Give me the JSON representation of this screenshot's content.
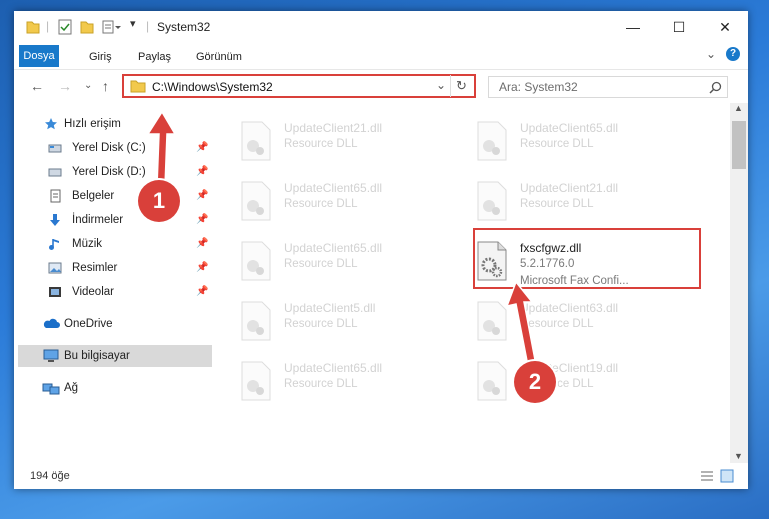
{
  "window": {
    "title": "System32",
    "controls": {
      "minimize": "—",
      "maximize": "☐",
      "close": "✕"
    }
  },
  "ribbon": {
    "tabs": [
      {
        "label": "Dosya",
        "active": true
      },
      {
        "label": "Giriş"
      },
      {
        "label": "Paylaş"
      },
      {
        "label": "Görünüm"
      }
    ]
  },
  "address": {
    "path": "C:\\Windows\\System32"
  },
  "search": {
    "placeholder": "Ara: System32"
  },
  "sidebar": {
    "items": [
      {
        "label": "Hızlı erişim",
        "icon": "star-icon"
      },
      {
        "label": "Yerel Disk (C:)",
        "icon": "drive-icon",
        "pinned": true
      },
      {
        "label": "Yerel Disk (D:)",
        "icon": "drive-icon",
        "pinned": true
      },
      {
        "label": "Belgeler",
        "icon": "documents-icon",
        "pinned": true
      },
      {
        "label": "İndirmeler",
        "icon": "download-icon",
        "pinned": true
      },
      {
        "label": "Müzik",
        "icon": "music-icon",
        "pinned": true
      },
      {
        "label": "Resimler",
        "icon": "pictures-icon",
        "pinned": true
      },
      {
        "label": "Videolar",
        "icon": "videos-icon",
        "pinned": true
      },
      {
        "label": "OneDrive",
        "icon": "onedrive-icon"
      },
      {
        "label": "Bu bilgisayar",
        "icon": "computer-icon",
        "selected": true
      },
      {
        "label": "Ağ",
        "icon": "network-icon"
      }
    ]
  },
  "files": [
    {
      "name": "UpdateClient21.dll",
      "desc": "Resource DLL"
    },
    {
      "name": "UpdateClient65.dll",
      "desc": "Resource DLL"
    },
    {
      "name": "UpdateClient65.dll",
      "desc": "Resource DLL"
    },
    {
      "name": "UpdateClient21.dll",
      "desc": "Resource DLL"
    },
    {
      "name": "UpdateClient65.dll",
      "desc": "Resource DLL"
    },
    {
      "name": "fxscfgwz.dll",
      "version": "5.2.1776.0",
      "desc": "Microsoft Fax Confi...",
      "highlighted": true
    },
    {
      "name": "UpdateClient5.dll",
      "desc": "Resource DLL"
    },
    {
      "name": "UpdateClient63.dll",
      "desc": "Resource DLL"
    },
    {
      "name": "UpdateClient65.dll",
      "desc": "Resource DLL"
    },
    {
      "name": "UpdateClient19.dll",
      "desc": "Resource DLL"
    }
  ],
  "status": {
    "count": "194 öğe"
  },
  "annotations": {
    "step1": "1",
    "step2": "2"
  },
  "colors": {
    "accent": "#1979ca",
    "annotation": "#d9403a"
  }
}
